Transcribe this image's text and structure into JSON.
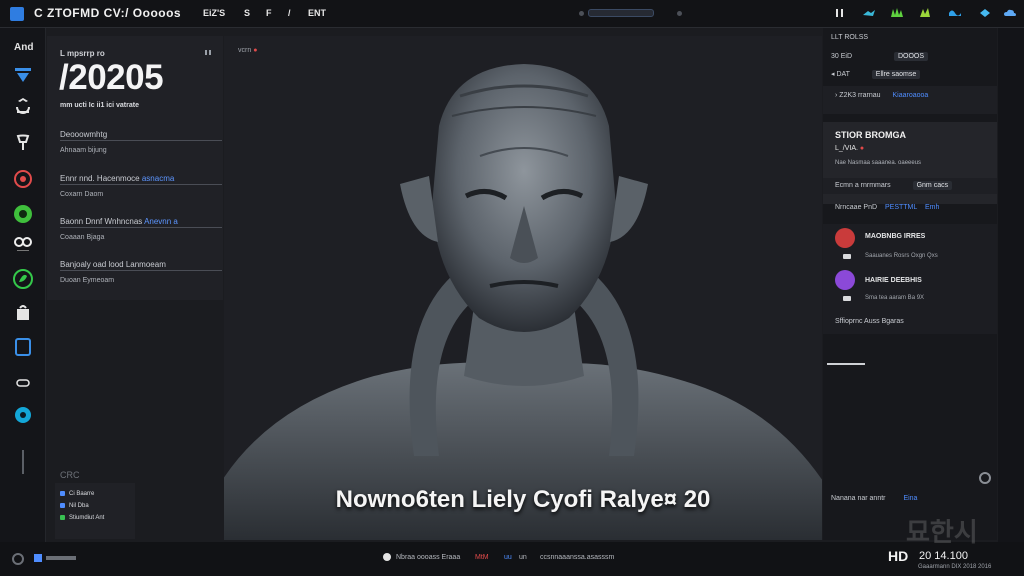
{
  "topbar": {
    "title": "C ZTOFMD CV:/ Ooooos",
    "items": [
      "EiZ'S",
      "S",
      "F",
      "/",
      "ENT"
    ]
  },
  "rail": {
    "label": "And",
    "icons": [
      "triangle-icon",
      "recycle-icon",
      "pin-icon",
      "target-icon",
      "planet-icon",
      "eyes-icon",
      "leaf-icon",
      "bag-icon",
      "frame-icon",
      "cloud-icon",
      "swirl-icon"
    ]
  },
  "info": {
    "kicker": "L mpsrrp ro",
    "number": "/20205",
    "subtitle": "mm ucti Ic ii1 ici vatrate",
    "blocks": [
      {
        "title": "Deooowmhtg",
        "accent": "",
        "sub": "Ahnaam bijung"
      },
      {
        "title": "Ennr nnd. Hacenmoce",
        "accent": "asnacma",
        "sub": "Coxarn Daom"
      },
      {
        "title": "Baonn Dnnf Wnhncnas",
        "accent": "Anevnn a",
        "sub": "Coaaan Bjaga"
      },
      {
        "title": "Banjoaly oad lood Lanmoeam",
        "accent": "",
        "sub": "Duoan Eymeoam"
      }
    ]
  },
  "viewport": {
    "label": "vcrn",
    "caption": "Nowno6ten Liely Cyofi Ralye¤ 20"
  },
  "right": {
    "header": "LLT ROLSS",
    "row1": {
      "left": "30 EiD",
      "tag": "DOOOS"
    },
    "row2": {
      "left": "DAT",
      "tag": "Ellre saomse"
    },
    "row3": {
      "left": "Z2K3 rrarnau",
      "link": "Kiaaroaooa"
    },
    "feature": {
      "title": "STIOR BROMGA",
      "sub": "L_/VIA.",
      "meta": "Nae  Nasmaa  saaanea. oaeeeus"
    },
    "row4": {
      "left": "Ecmn a rnrmmars",
      "tag": "Gnm cacs"
    },
    "row5": {
      "text": "Nrncaae PnD",
      "link": "PESTTML",
      "end": "Emh"
    },
    "comments": [
      {
        "name": "MAOBNBG IRRES",
        "meta": "Saauanes Rosrs Oxgn Qxs"
      },
      {
        "name": "HAIRIE DEEBHIS",
        "meta": "Sma tea aaram Ba 9X"
      }
    ],
    "row6": {
      "text": "Sffioprnc Auss Bgaras"
    },
    "bottom_row": {
      "left": "Nanana nar anntr",
      "tag": "Eina"
    }
  },
  "layers": {
    "title": "CRC",
    "items": [
      "Ci Baarre",
      "Nil Dba",
      "Stiumdiut Ant"
    ]
  },
  "bottombar": {
    "items": [
      {
        "text": "Nbraa oooass Eraaa",
        "color": "#b5b8be"
      },
      {
        "text": "MtM",
        "color": "#e14b4b"
      },
      {
        "text": "uu",
        "color": "#4f8dff"
      },
      {
        "text": "un",
        "color": "#b5b8be"
      },
      {
        "text": "ccsnnaaanssa.asasssm",
        "color": "#b5b8be"
      }
    ],
    "logo": "HD",
    "time": "20 14.100",
    "small": "Gaaarmann DIX 2018 2016"
  },
  "watermark": "묘한시",
  "colors": {
    "accent": "#2f7de1",
    "link": "#4f8dff",
    "alert": "#e14b4b",
    "green": "#38c152",
    "purple": "#8b49d8"
  }
}
